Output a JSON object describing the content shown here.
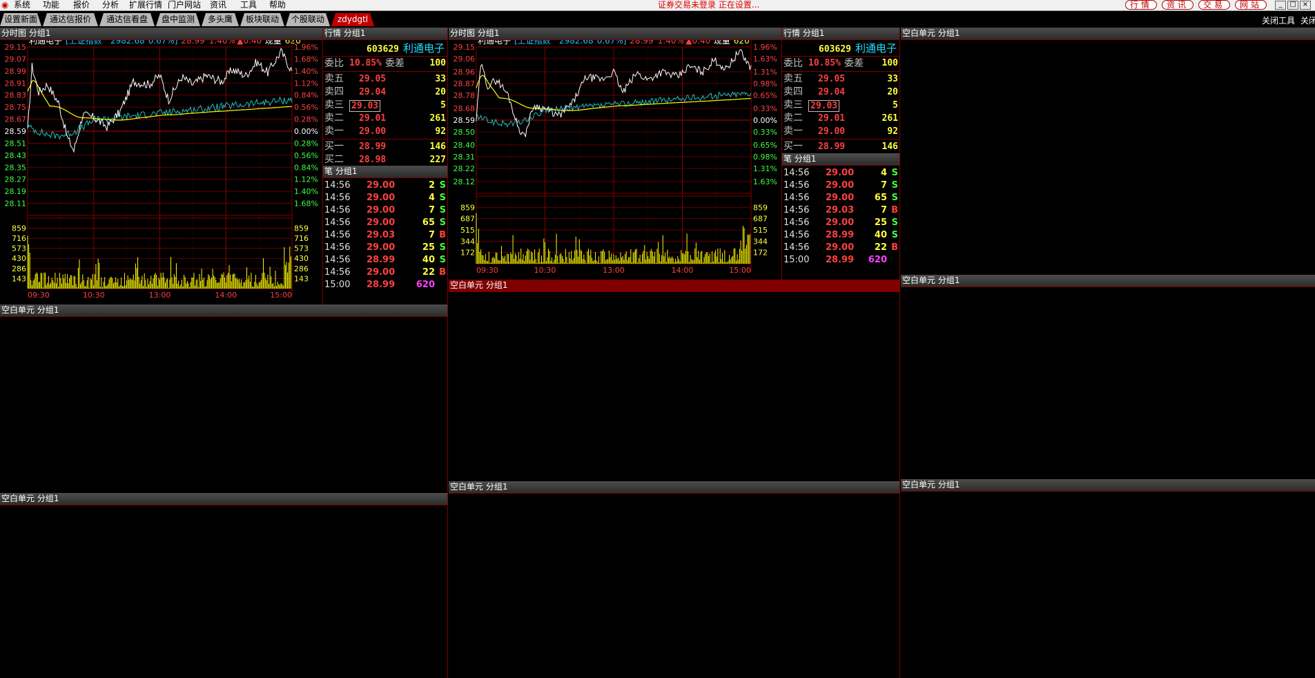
{
  "menu": {
    "logo": "◉",
    "items": [
      "系统",
      "功能",
      "报价",
      "分析",
      "扩展行情",
      "门户网站",
      "资讯",
      "工具",
      "帮助"
    ],
    "status": "证券交易未登录  正在设置..."
  },
  "right_buttons": [
    "行情",
    "资讯",
    "交易",
    "网站"
  ],
  "window_controls": [
    "_",
    "□",
    "×"
  ],
  "tabs": [
    "设置新面",
    "通达信报价",
    "通达信看盘",
    "盘中监测",
    "多头鹰",
    "板块联动",
    "个股联动",
    "zdydgtl"
  ],
  "toolbar_right": {
    "close_tool": "关闭工具",
    "close": "关闭"
  },
  "panel_titles": {
    "chart": "分时图 分组1",
    "quote": "行情 分组1",
    "ticks": "笔 分组1",
    "blank": "空白单元 分组1"
  },
  "stock": {
    "code": "603629",
    "name": "利通电子",
    "weibi_label": "委比",
    "weibi": "10.85%",
    "weicha_label": "委差",
    "weicha": "100",
    "asks": [
      {
        "label": "卖五",
        "price": "29.05",
        "vol": "33"
      },
      {
        "label": "卖四",
        "price": "29.04",
        "vol": "20"
      },
      {
        "label": "卖三",
        "price": "29.03",
        "vol": "5"
      },
      {
        "label": "卖二",
        "price": "29.01",
        "vol": "261"
      },
      {
        "label": "卖一",
        "price": "29.00",
        "vol": "92"
      }
    ],
    "bids": [
      {
        "label": "买一",
        "price": "28.99",
        "vol": "146"
      },
      {
        "label": "买二",
        "price": "28.98",
        "vol": "227"
      }
    ]
  },
  "ticks_left": [
    {
      "t": "14:56",
      "p": "29.00",
      "v": "2",
      "f": "S"
    },
    {
      "t": "14:56",
      "p": "29.00",
      "v": "4",
      "f": "S"
    },
    {
      "t": "14:56",
      "p": "29.00",
      "v": "7",
      "f": "S"
    },
    {
      "t": "14:56",
      "p": "29.00",
      "v": "65",
      "f": "S"
    },
    {
      "t": "14:56",
      "p": "29.03",
      "v": "7",
      "f": "B"
    },
    {
      "t": "14:56",
      "p": "29.00",
      "v": "25",
      "f": "S"
    },
    {
      "t": "14:56",
      "p": "28.99",
      "v": "40",
      "f": "S"
    },
    {
      "t": "14:56",
      "p": "29.00",
      "v": "22",
      "f": "B"
    },
    {
      "t": "15:00",
      "p": "28.99",
      "v": "620",
      "f": ""
    }
  ],
  "ticks_right": [
    {
      "t": "14:56",
      "p": "29.00",
      "v": "4",
      "f": "S"
    },
    {
      "t": "14:56",
      "p": "29.00",
      "v": "7",
      "f": "S"
    },
    {
      "t": "14:56",
      "p": "29.00",
      "v": "65",
      "f": "S"
    },
    {
      "t": "14:56",
      "p": "29.03",
      "v": "7",
      "f": "B"
    },
    {
      "t": "14:56",
      "p": "29.00",
      "v": "25",
      "f": "S"
    },
    {
      "t": "14:56",
      "p": "28.99",
      "v": "40",
      "f": "S"
    },
    {
      "t": "14:56",
      "p": "29.00",
      "v": "22",
      "f": "B"
    },
    {
      "t": "15:00",
      "p": "28.99",
      "v": "620",
      "f": ""
    }
  ],
  "colors": {
    "up": "#ff4040",
    "down": "#40ff40",
    "flat": "#ffffff",
    "price_line": "#ffffff",
    "avg_line": "#ffff00",
    "index_line": "#20c0c0",
    "volume": "#ffff00",
    "grid": "#800000",
    "buy_flag": "#ff4040",
    "sell_flag": "#40ff40",
    "final_vol": "#ff40ff"
  },
  "chart_data": [
    {
      "type": "line",
      "info": {
        "name": "利通电子",
        "index_label": "[上证指数",
        "index_value": "2982.68",
        "index_pct": "0.67%]",
        "price": "28.99",
        "pct": "1.40%",
        "change": "▲0.40",
        "vol_label": "现量",
        "vol": "620"
      },
      "prev_close": 28.59,
      "price_ticks": [
        "29.15",
        "29.07",
        "28.99",
        "28.91",
        "28.83",
        "28.75",
        "28.67",
        "28.59",
        "28.51",
        "28.43",
        "28.35",
        "28.27",
        "28.19",
        "28.11"
      ],
      "pct_ticks": [
        "1.96%",
        "1.68%",
        "1.40%",
        "1.12%",
        "0.84%",
        "0.56%",
        "0.28%",
        "0.00%",
        "0.28%",
        "0.56%",
        "0.84%",
        "1.12%",
        "1.40%",
        "1.68%"
      ],
      "vol_ticks": [
        "859",
        "716",
        "573",
        "430",
        "286",
        "143"
      ],
      "x_labels": [
        "09:30",
        "10:30",
        "13:00",
        "14:00",
        "15:00"
      ],
      "ylim": [
        28.03,
        29.15
      ],
      "vmax": 1002
    },
    {
      "type": "line",
      "info": {
        "name": "利通电子",
        "index_label": "[上证指数",
        "index_value": "2982.68",
        "index_pct": "0.67%]",
        "price": "28.99",
        "pct": "1.40%",
        "change": "▲0.40",
        "vol_label": "现量",
        "vol": "620"
      },
      "prev_close": 28.59,
      "price_ticks": [
        "29.15",
        "29.06",
        "28.96",
        "28.87",
        "28.78",
        "28.68",
        "28.59",
        "28.50",
        "28.40",
        "28.31",
        "28.22",
        "28.12"
      ],
      "pct_ticks": [
        "1.96%",
        "1.63%",
        "1.31%",
        "0.98%",
        "0.65%",
        "0.33%",
        "0.00%",
        "0.33%",
        "0.65%",
        "0.98%",
        "1.31%",
        "1.63%"
      ],
      "vol_ticks": [
        "859",
        "687",
        "515",
        "344",
        "172"
      ],
      "x_labels": [
        "09:30",
        "10:30",
        "13:00",
        "14:00",
        "15:00"
      ],
      "ylim": [
        28.03,
        29.15
      ],
      "vmax": 1030
    }
  ]
}
